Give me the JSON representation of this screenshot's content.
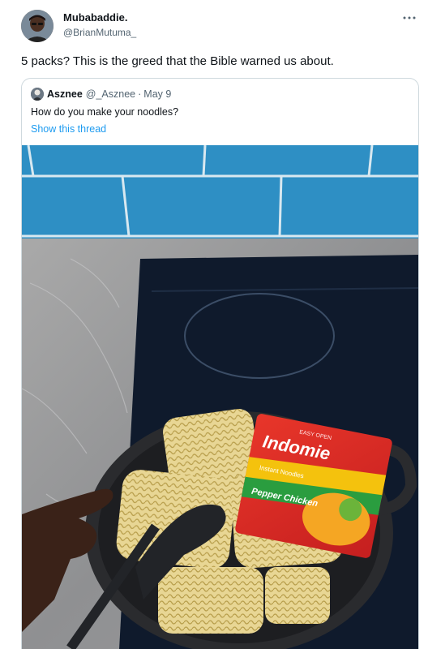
{
  "tweet": {
    "author_name": "Mubabaddie.",
    "author_handle": "@BrianMutuma_",
    "more_icon": "more-horizontal-icon",
    "text": "5 packs? This is the greed that the Bible warned us about."
  },
  "quoted": {
    "author_name": "Asznee",
    "author_handle": "@_Asznee",
    "separator": "·",
    "date": "May 9",
    "text": "How do you make your noodles?",
    "show_thread": "Show this thread"
  },
  "photo": {
    "package_brand": "Indomie",
    "package_subtitle": "Instant Noodles",
    "package_flavor": "Pepper Chicken",
    "package_top": "EASY OPEN"
  },
  "colors": {
    "link": "#1d9bf0",
    "secondary_text": "#536471",
    "border": "#cfd9de",
    "tile_blue": "#2e8fc4"
  }
}
